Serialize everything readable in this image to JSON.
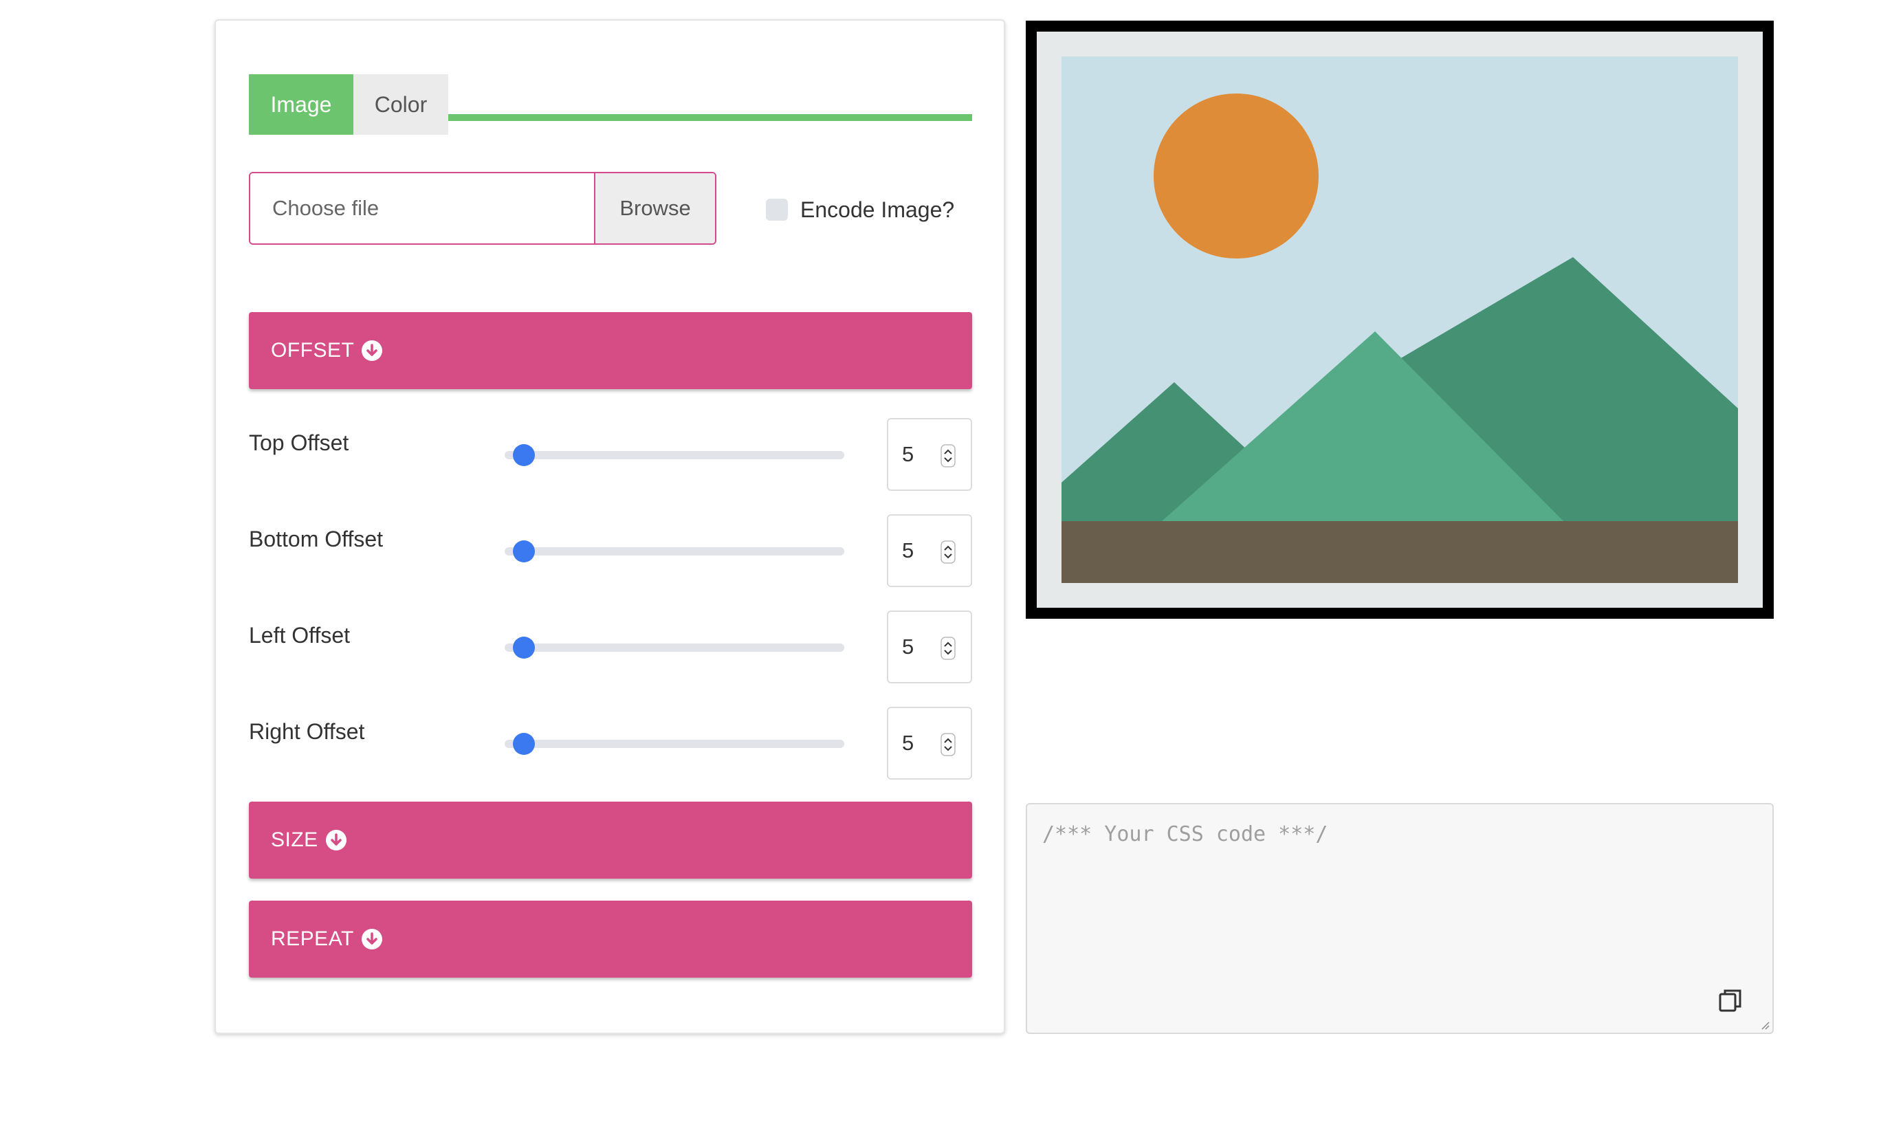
{
  "tabs": [
    {
      "label": "Image",
      "active": true
    },
    {
      "label": "Color",
      "active": false
    }
  ],
  "file": {
    "placeholder": "Choose file",
    "browse_label": "Browse",
    "encode_label": "Encode Image?",
    "encode_checked": false
  },
  "sections": {
    "offset": "OFFSET",
    "size": "SIZE",
    "repeat": "REPEAT"
  },
  "offsets": [
    {
      "label": "Top Offset",
      "value": "5",
      "slider": 0.05
    },
    {
      "label": "Bottom Offset",
      "value": "5",
      "slider": 0.05
    },
    {
      "label": "Left Offset",
      "value": "5",
      "slider": 0.05
    },
    {
      "label": "Right Offset",
      "value": "5",
      "slider": 0.05
    }
  ],
  "code": {
    "placeholder": "/*** Your CSS code ***/"
  },
  "colors": {
    "tab_active": "#6cc46e",
    "accordion": "#d64d86",
    "slider_thumb": "#3b79f0",
    "sky": "#c9dfe8",
    "sun": "#df8c38",
    "mountain_dark": "#459174",
    "mountain_light": "#55ab88",
    "ground": "#695d4c"
  },
  "icons": {
    "accordion": "arrow-circle-down-icon",
    "spinner": "spinner-arrows-icon",
    "copy": "copy-icon"
  }
}
